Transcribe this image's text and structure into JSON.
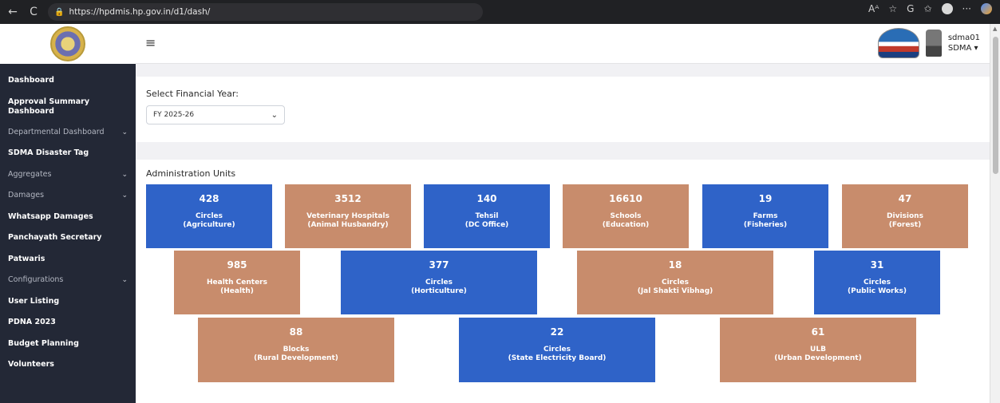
{
  "browser": {
    "url": "https://hpdmis.hp.gov.in/d1/dash/",
    "back_glyph": "←",
    "refresh_glyph": "C",
    "lock_glyph": "🔒",
    "read_aloud": "Aᴬ",
    "menu_glyph": "···"
  },
  "header": {
    "menu_glyph": "≡",
    "user_name": "sdma01",
    "user_role": "SDMA ▾"
  },
  "sidebar": {
    "items": [
      {
        "label": "Dashboard",
        "dim": false,
        "has_chevron": false
      },
      {
        "label": "Approval Summary Dashboard",
        "dim": false,
        "has_chevron": false
      },
      {
        "label": "Departmental Dashboard",
        "dim": true,
        "has_chevron": true
      },
      {
        "label": "SDMA Disaster Tag",
        "dim": false,
        "has_chevron": false
      },
      {
        "label": "Aggregates",
        "dim": true,
        "has_chevron": true
      },
      {
        "label": "Damages",
        "dim": true,
        "has_chevron": true
      },
      {
        "label": "Whatsapp Damages",
        "dim": false,
        "has_chevron": false
      },
      {
        "label": "Panchayath Secretary",
        "dim": false,
        "has_chevron": false
      },
      {
        "label": "Patwaris",
        "dim": false,
        "has_chevron": false
      },
      {
        "label": "Configurations",
        "dim": true,
        "has_chevron": true
      },
      {
        "label": "User Listing",
        "dim": false,
        "has_chevron": false
      },
      {
        "label": "PDNA 2023",
        "dim": false,
        "has_chevron": false
      },
      {
        "label": "Budget Planning",
        "dim": false,
        "has_chevron": false
      },
      {
        "label": "Volunteers",
        "dim": false,
        "has_chevron": false
      }
    ]
  },
  "financial_year": {
    "label": "Select Financial Year:",
    "selected": "FY 2025-26"
  },
  "admin_units": {
    "title": "Administration Units",
    "tiles": [
      {
        "value": "428",
        "name": "Circles",
        "dept": "(Agriculture)",
        "color": "blue"
      },
      {
        "value": "3512",
        "name": "Veterinary Hospitals",
        "dept": "(Animal Husbandry)",
        "color": "tan"
      },
      {
        "value": "140",
        "name": "Tehsil",
        "dept": "(DC Office)",
        "color": "blue"
      },
      {
        "value": "16610",
        "name": "Schools",
        "dept": "(Education)",
        "color": "tan"
      },
      {
        "value": "19",
        "name": "Farms",
        "dept": "(Fisheries)",
        "color": "blue"
      },
      {
        "value": "47",
        "name": "Divisions",
        "dept": "(Forest)",
        "color": "tan"
      },
      {
        "value": "985",
        "name": "Health Centers",
        "dept": "(Health)",
        "color": "tan"
      },
      {
        "value": "377",
        "name": "Circles",
        "dept": "(Horticulture)",
        "color": "blue"
      },
      {
        "value": "18",
        "name": "Circles",
        "dept": "(Jal Shakti Vibhag)",
        "color": "tan"
      },
      {
        "value": "31",
        "name": "Circles",
        "dept": "(Public Works)",
        "color": "blue"
      },
      {
        "value": "88",
        "name": "Blocks",
        "dept": "(Rural Development)",
        "color": "tan"
      },
      {
        "value": "22",
        "name": "Circles",
        "dept": "(State Electricity Board)",
        "color": "blue"
      },
      {
        "value": "61",
        "name": "ULB",
        "dept": "(Urban Development)",
        "color": "tan"
      }
    ]
  },
  "colors": {
    "blue": "#2f63c8",
    "tan": "#c88c6c",
    "sidebar": "#232836"
  }
}
